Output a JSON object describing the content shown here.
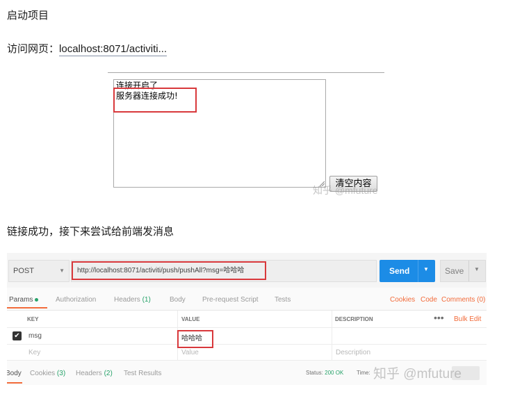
{
  "article": {
    "heading1": "启动项目",
    "visit_prefix": "访问网页：",
    "visit_link": "localhost:8071/activiti...",
    "heading2": "链接成功，接下来尝试给前端发消息"
  },
  "websocket_page": {
    "textarea_lines": [
      "连接开启了",
      "服务器连接成功!"
    ],
    "clear_button": "清空内容"
  },
  "watermark": "知乎 @mfuture",
  "postman": {
    "method": "POST",
    "url": "http://localhost:8071/activiti/push/pushAll?msg=哈哈哈",
    "send_label": "Send",
    "save_label": "Save",
    "tabs": {
      "params": "Params",
      "authorization": "Authorization",
      "headers": "Headers",
      "headers_count": "(1)",
      "body": "Body",
      "prerequest": "Pre-request Script",
      "tests": "Tests"
    },
    "links": {
      "cookies": "Cookies",
      "code": "Code",
      "comments": "Comments (0)"
    },
    "table": {
      "headers": {
        "key": "KEY",
        "value": "VALUE",
        "description": "DESCRIPTION"
      },
      "bulk_edit": "Bulk Edit",
      "row": {
        "key": "msg",
        "value": "哈哈哈"
      },
      "placeholders": {
        "key": "Key",
        "value": "Value",
        "description": "Description"
      }
    },
    "response": {
      "body": "Body",
      "cookies": "Cookies",
      "cookies_count": "(3)",
      "headers": "Headers",
      "headers_count": "(2)",
      "test_results": "Test Results",
      "status_label": "Status:",
      "status_value": "200 OK",
      "time_label": "Time:"
    }
  }
}
